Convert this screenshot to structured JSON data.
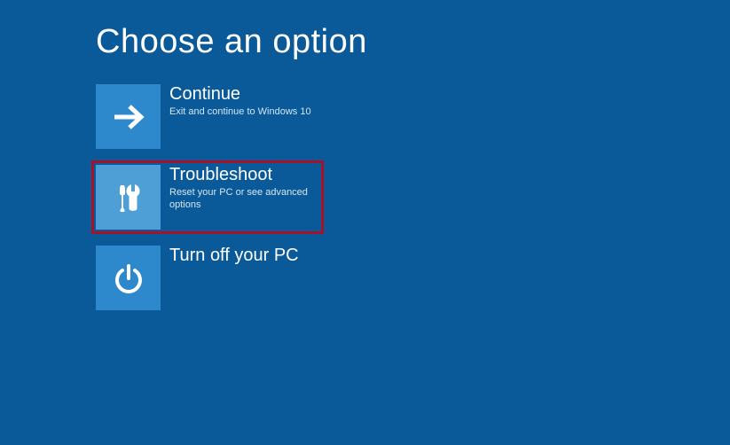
{
  "page": {
    "title": "Choose an option"
  },
  "options": [
    {
      "id": "continue",
      "title": "Continue",
      "description": "Exit and continue to Windows 10",
      "icon": "arrow-right-icon",
      "highlighted": false
    },
    {
      "id": "troubleshoot",
      "title": "Troubleshoot",
      "description": "Reset your PC or see advanced options",
      "icon": "tools-icon",
      "highlighted": true
    },
    {
      "id": "turnoff",
      "title": "Turn off your PC",
      "description": "",
      "icon": "power-icon",
      "highlighted": false
    }
  ],
  "colors": {
    "background": "#0a5a99",
    "tile": "#2d89cc",
    "tile_highlighted": "#4d9fd6",
    "highlight_border": "#a51229"
  }
}
